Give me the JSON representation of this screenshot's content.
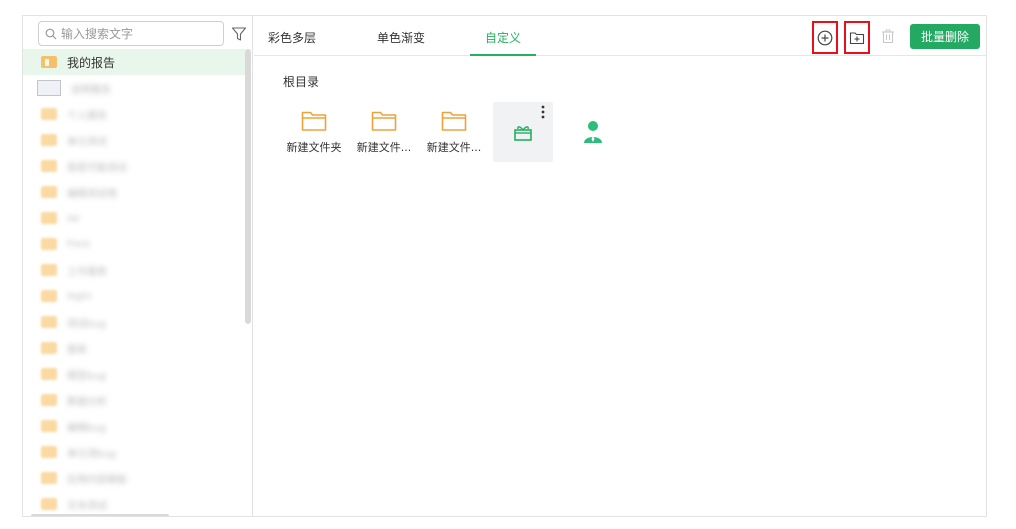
{
  "sidebar": {
    "search_placeholder": "输入搜索文字",
    "tree": [
      {
        "label": "我的报告",
        "selected": true,
        "type": "folder"
      },
      {
        "label": "说明报告",
        "type": "doc",
        "blurred": true
      },
      {
        "label": "个人报告",
        "type": "folder",
        "blurred": true
      },
      {
        "label": "单元测试",
        "type": "folder",
        "blurred": true
      },
      {
        "label": "我是可能测试",
        "type": "folder",
        "blurred": true
      },
      {
        "label": "编辑测试用",
        "type": "folder",
        "blurred": true
      },
      {
        "label": "aa",
        "type": "folder",
        "blurred": true
      },
      {
        "label": "Fons",
        "type": "folder",
        "blurred": true
      },
      {
        "label": "工作报表",
        "type": "folder",
        "blurred": true
      },
      {
        "label": "login",
        "type": "folder",
        "blurred": true
      },
      {
        "label": "测试bug",
        "type": "folder",
        "blurred": true
      },
      {
        "label": "报表",
        "type": "folder",
        "blurred": true
      },
      {
        "label": "模型bug",
        "type": "folder",
        "blurred": true
      },
      {
        "label": "数据分析",
        "type": "folder",
        "blurred": true
      },
      {
        "label": "编辑bug",
        "type": "folder",
        "blurred": true
      },
      {
        "label": "单元测bug",
        "type": "folder",
        "blurred": true
      },
      {
        "label": "应用内容模板",
        "type": "folder",
        "blurred": true
      },
      {
        "label": "文本测试",
        "type": "folder",
        "blurred": true
      }
    ]
  },
  "tabs": [
    {
      "label": "彩色多层"
    },
    {
      "label": "单色渐变"
    },
    {
      "label": "自定义",
      "active": true
    }
  ],
  "toolbar": {
    "batch_delete_label": "批量删除"
  },
  "breadcrumb": "根目录",
  "items": [
    {
      "label": "新建文件夹",
      "icon": "folder-icon"
    },
    {
      "label": "新建文件...",
      "icon": "folder-icon"
    },
    {
      "label": "新建文件...",
      "icon": "folder-icon"
    },
    {
      "label": "",
      "icon": "gift-icon"
    },
    {
      "label": "",
      "icon": "person-icon"
    }
  ],
  "colors": {
    "accent": "#23a961",
    "folder": "#f0a23a",
    "highlight_border": "#e8101a"
  }
}
